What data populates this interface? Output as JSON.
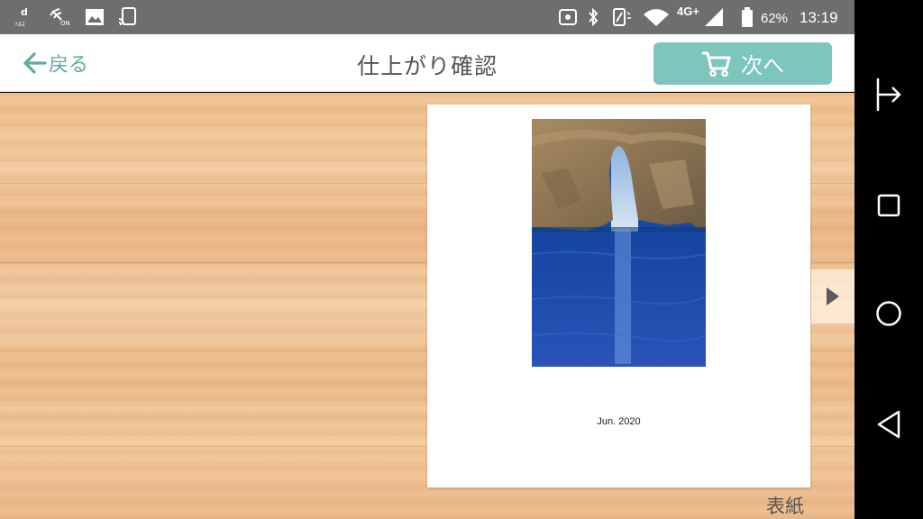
{
  "status_bar": {
    "battery_text": "62%",
    "time": "13:19",
    "network_label": "4G+",
    "left_icons": [
      "d-health-icon",
      "vibrate-on-icon",
      "image-icon",
      "cast-icon"
    ],
    "right_icons": [
      "nfc-icon",
      "bluetooth-icon",
      "vibrate-icon",
      "wifi-icon",
      "signal-icon",
      "battery-icon"
    ]
  },
  "header": {
    "back_label": "戻る",
    "title": "仕上がり確認",
    "next_label": "次へ"
  },
  "preview": {
    "date_text": "Jun. 2020",
    "page_label": "表紙",
    "photo": "sea-arch-photo"
  },
  "colors": {
    "accent": "#5fa9a3",
    "button_bg": "#7dc5bd",
    "status_bar": "#6e6e6e",
    "wood": "#eebe8b"
  },
  "nav_bar": {
    "buttons": [
      "split-screen-icon",
      "recents-icon",
      "home-icon",
      "back-triangle-icon"
    ]
  }
}
